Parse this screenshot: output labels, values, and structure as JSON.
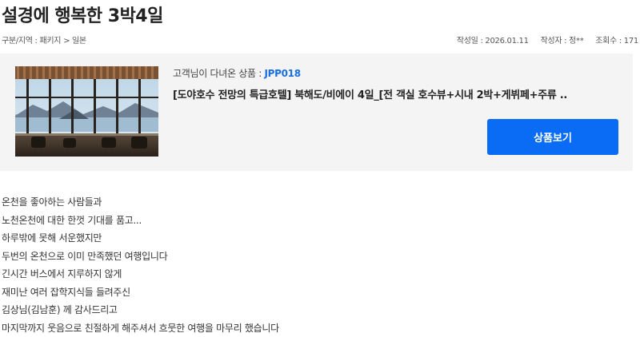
{
  "post": {
    "title": "설경에 행복한 3박4일",
    "category": "구분/지역 : 패키지 > 일본",
    "date": "작성일 : 2026.01.11",
    "author": "작성자 : 정**",
    "views": "조회수 : 171"
  },
  "product": {
    "visited_label": "고객님이 다녀온 상품 : ",
    "code": "JPP018",
    "name": "[도야호수 전망의 특급호텔] 북해도/비에이 4일_[전 객실 호수뷰+시내 2박+게뷔페+주류 ..",
    "view_button_label": "상품보기"
  },
  "body_lines": [
    "온천을 좋아하는 사람들과",
    "노천온천에 대한 한껏 기대를 품고...",
    "하루밖에 못해 서운했지만",
    "두번의 온천으로 이미 만족했던 여행입니다",
    "긴시간 버스에서 지루하지 않게",
    "재미난 여러 잡학지식들 들려주신",
    "김상님(김남훈) 께 감사드리고",
    "마지막까지 웃음으로 친절하게 해주셔서  흐뭇한 여행을 마무리 했습니다"
  ]
}
